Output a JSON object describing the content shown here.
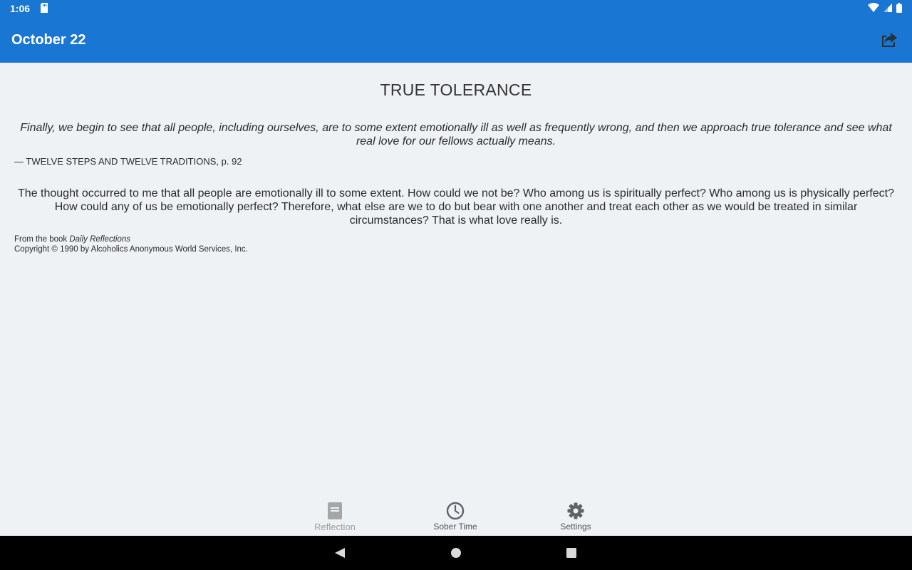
{
  "status_bar": {
    "time": "1:06",
    "left_icons": [
      "sd-card-icon"
    ],
    "right_icons": [
      "wifi-icon",
      "signal-icon",
      "battery-icon"
    ]
  },
  "app_bar": {
    "title": "October 22",
    "share_icon": "share-icon",
    "color": "#1976d2"
  },
  "reflection": {
    "title": "TRUE TOLERANCE",
    "quote": "Finally, we begin to see that all people, including ourselves, are to some extent emotionally ill as well as frequently wrong, and then we approach true tolerance and see what real love for our fellows actually means.",
    "source": "— TWELVE STEPS AND TWELVE TRADITIONS, p. 92",
    "body": "The thought occurred to me that all people are emotionally ill to some extent. How could we not be? Who among us is spiritually perfect? Who among us is physically perfect? How could any of us be emotionally perfect? Therefore, what else are we to do but bear with one another and treat each other as we would be treated in similar circumstances? That is what love really is.",
    "credit_prefix": "From the book ",
    "credit_book": "Daily Reflections",
    "copyright": "Copyright © 1990 by Alcoholics Anonymous World Services, Inc."
  },
  "bottom_nav": {
    "items": [
      {
        "label": "Reflection",
        "icon": "book-icon",
        "state": "inactive"
      },
      {
        "label": "Sober Time",
        "icon": "clock-icon",
        "state": "active"
      },
      {
        "label": "Settings",
        "icon": "gear-icon",
        "state": "active"
      }
    ]
  },
  "system_nav": {
    "buttons": [
      "back-icon",
      "home-icon",
      "recents-icon"
    ]
  }
}
